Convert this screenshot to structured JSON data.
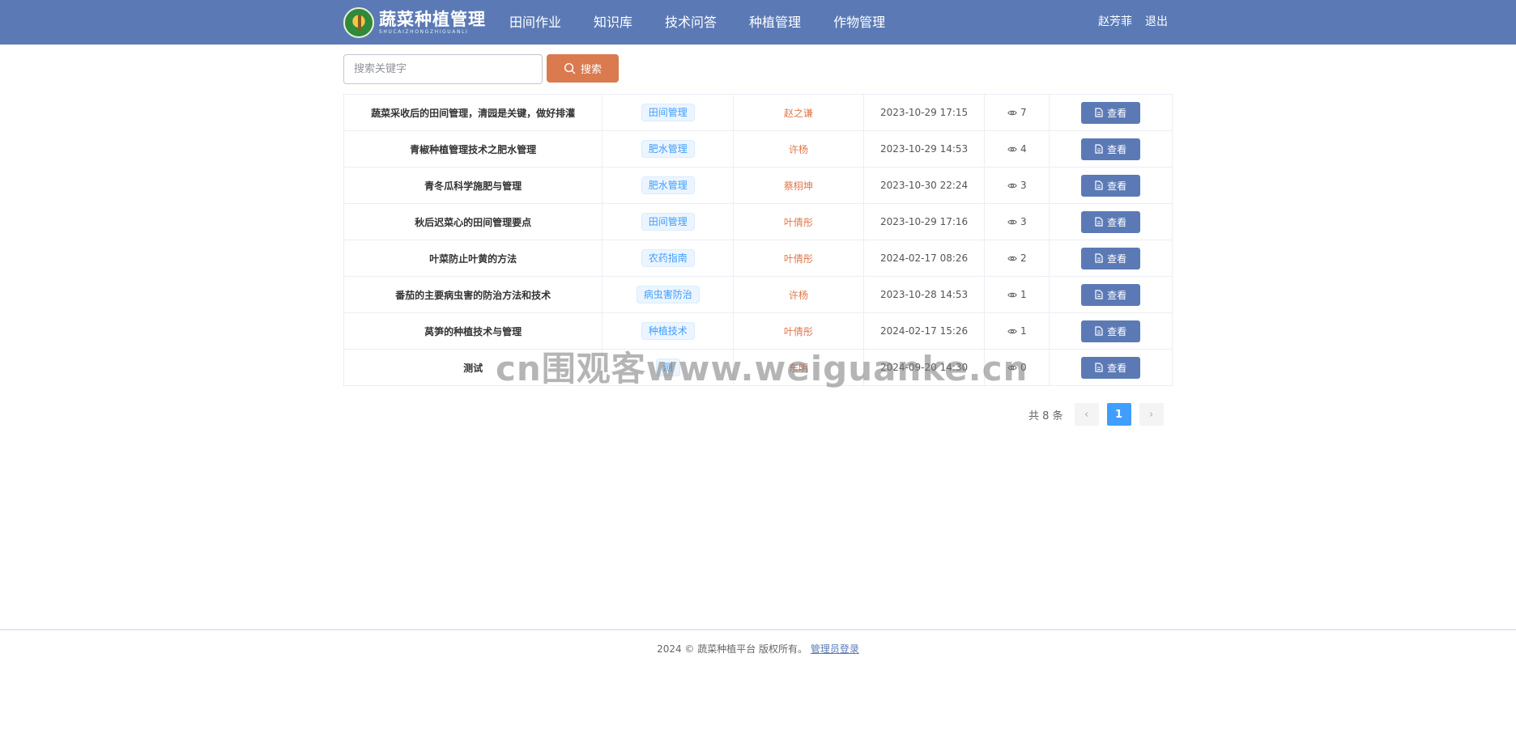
{
  "header": {
    "logo_title": "蔬菜种植管理",
    "logo_subtitle": "SHUCAIZHONGZHIGUANLI",
    "nav": [
      "田间作业",
      "知识库",
      "技术问答",
      "种植管理",
      "作物管理"
    ],
    "user": "赵芳菲",
    "logout": "退出"
  },
  "search": {
    "placeholder": "搜索关键字",
    "button_label": "搜索"
  },
  "table": {
    "rows": [
      {
        "title": "蔬菜采收后的田间管理，清园是关键，做好排灌",
        "tag": "田间管理",
        "author": "赵之谦",
        "date": "2023-10-29 17:15",
        "views": "7",
        "action": "查看"
      },
      {
        "title": "青椒种植管理技术之肥水管理",
        "tag": "肥水管理",
        "author": "许杨",
        "date": "2023-10-29 14:53",
        "views": "4",
        "action": "查看"
      },
      {
        "title": "青冬瓜科学施肥与管理",
        "tag": "肥水管理",
        "author": "蔡栩坤",
        "date": "2023-10-30 22:24",
        "views": "3",
        "action": "查看"
      },
      {
        "title": "秋后迟菜心的田间管理要点",
        "tag": "田间管理",
        "author": "叶倩彤",
        "date": "2023-10-29 17:16",
        "views": "3",
        "action": "查看"
      },
      {
        "title": "叶菜防止叶黄的方法",
        "tag": "农药指南",
        "author": "叶倩彤",
        "date": "2024-02-17 08:26",
        "views": "2",
        "action": "查看"
      },
      {
        "title": "番茄的主要病虫害的防治方法和技术",
        "tag": "病虫害防治",
        "author": "许杨",
        "date": "2023-10-28 14:53",
        "views": "1",
        "action": "查看"
      },
      {
        "title": "莴笋的种植技术与管理",
        "tag": "种植技术",
        "author": "叶倩彤",
        "date": "2024-02-17 15:26",
        "views": "1",
        "action": "查看"
      },
      {
        "title": "测试",
        "tag": "测",
        "author": "东明",
        "date": "2024-09-20 14:30",
        "views": "0",
        "action": "查看"
      }
    ]
  },
  "pagination": {
    "total_text": "共 8 条",
    "current_page": "1",
    "prev": "‹",
    "next": "›"
  },
  "footer": {
    "text": "2024 © 蔬菜种植平台 版权所有。",
    "admin_link": "管理员登录"
  },
  "watermark": "cn围观客www.weiguanke.cn",
  "colors": {
    "navbar": "#5b7ab5",
    "search_button": "#d97a4f",
    "author_text": "#e0764b",
    "tag_text": "#409eff",
    "pager_active": "#409eff"
  },
  "icons": {
    "search_button": "search-icon",
    "views": "eye-icon",
    "view_button": "document-icon"
  }
}
